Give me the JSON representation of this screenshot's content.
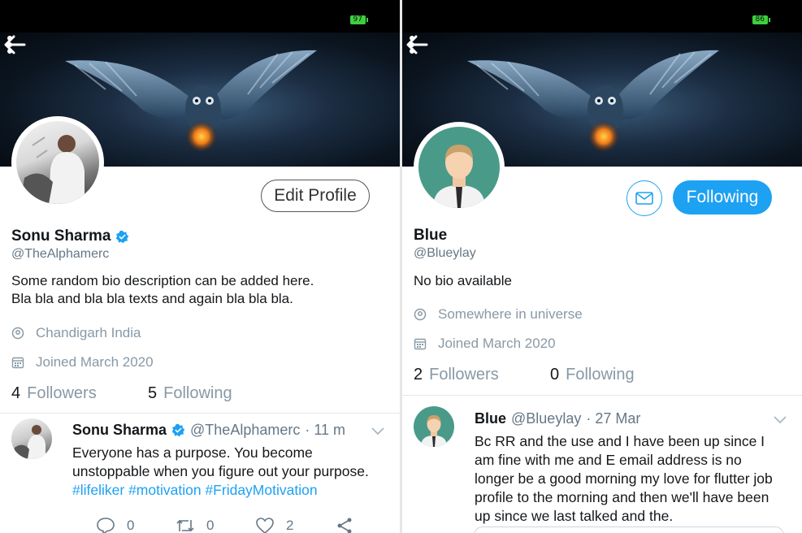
{
  "colors": {
    "accent": "#1da1f2",
    "battery": "#3ecf3e",
    "muted": "#8899a6"
  },
  "left": {
    "status": {
      "battery": "97"
    },
    "profile": {
      "name": "Sonu Sharma",
      "handle": "@TheAlphamerc",
      "bio": "Some random bio description can be added here.\nBla bla and bla bla texts and again bla bla bla.",
      "location": "Chandigarh India",
      "joined": "Joined March 2020",
      "followers_count": "4",
      "followers_label": "Followers",
      "following_count": "5",
      "following_label": "Following",
      "edit_label": "Edit Profile",
      "verified": true
    },
    "tweet": {
      "author": "Sonu Sharma",
      "handle": "@TheAlphamerc",
      "time": "· 11 m",
      "text": "Everyone has a purpose. You become unstoppable when you figure out your purpose.",
      "hashtags": [
        "#lifeliker",
        "#motivation",
        "#FridayMotivation"
      ],
      "reply_count": "0",
      "retweet_count": "0",
      "like_count": "2"
    }
  },
  "right": {
    "status": {
      "battery": "86"
    },
    "profile": {
      "name": "Blue",
      "handle": "@Blueylay",
      "bio": "No bio available",
      "location": "Somewhere in universe",
      "joined": "Joined March 2020",
      "followers_count": "2",
      "followers_label": "Followers",
      "following_count": "0",
      "following_label": "Following",
      "following_button": "Following"
    },
    "tweet": {
      "author": "Blue",
      "handle": "@Blueylay",
      "time": "· 27 Mar",
      "text": "Bc RR and the use and I have been up since I am fine with me and E email address is no longer be a good morning my love for flutter job profile to the morning and then we'll have been up since we last talked and the."
    }
  },
  "icons": [
    "back-arrow-icon",
    "more-vertical-icon",
    "verified-icon",
    "location-icon",
    "calendar-icon",
    "chevron-down-icon",
    "reply-icon",
    "retweet-icon",
    "like-icon",
    "share-icon",
    "mail-icon"
  ]
}
